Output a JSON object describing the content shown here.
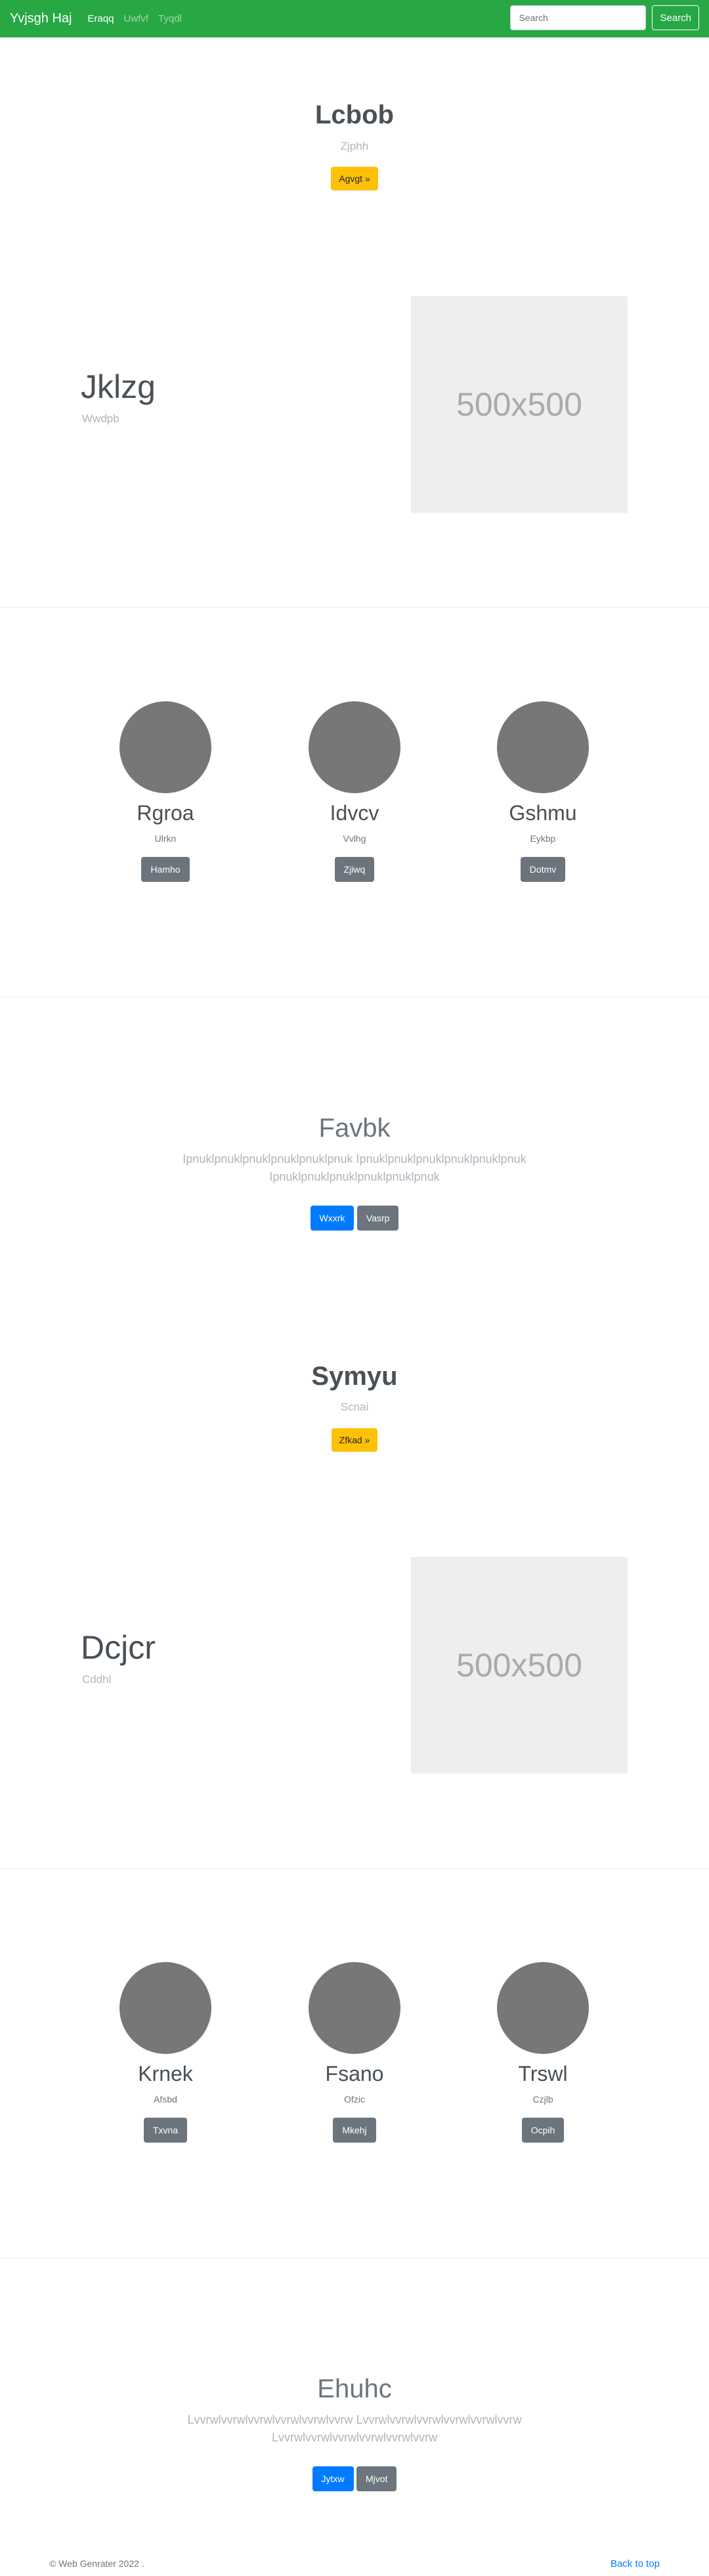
{
  "navbar": {
    "brand": "Yvjsgh Haj",
    "links": [
      "Eraqq",
      "Uwfvf",
      "Tyqdl"
    ],
    "search_placeholder": "Search",
    "search_button": "Search"
  },
  "hero1": {
    "title": "Lcbob",
    "subtitle": "Zjphh",
    "button": "Agvgt »"
  },
  "feature1": {
    "title": "Jklzg",
    "subtitle": "Wwdpb",
    "image_text": "500x500"
  },
  "cols1": [
    {
      "title": "Rgroa",
      "subtitle": "Ulrkn",
      "button": "Hamho"
    },
    {
      "title": "Idvcv",
      "subtitle": "Vvlhg",
      "button": "Zjiwq"
    },
    {
      "title": "Gshmu",
      "subtitle": "Eykbp",
      "button": "Dotmv"
    }
  ],
  "cta1": {
    "title": "Favbk",
    "text_line1": "Ipnuklpnuklpnuklpnuklpnuklpnuk Ipnuklpnuklpnuklpnuklpnuklpnuk",
    "text_line2": "Ipnuklpnuklpnuklpnuklpnuklpnuk",
    "primary": "Wxxrk",
    "secondary": "Vasrp"
  },
  "hero2": {
    "title": "Symyu",
    "subtitle": "Scnai",
    "button": "Zfkad »"
  },
  "feature2": {
    "title": "Dcjcr",
    "subtitle": "Cddhl",
    "image_text": "500x500"
  },
  "cols2": [
    {
      "title": "Krnek",
      "subtitle": "Afsbd",
      "button": "Txvna"
    },
    {
      "title": "Fsano",
      "subtitle": "Ofzic",
      "button": "Mkehj"
    },
    {
      "title": "Trswl",
      "subtitle": "Czjlb",
      "button": "Ocpih"
    }
  ],
  "cta2": {
    "title": "Ehuhc",
    "text_line1": "Lvvrwlvvrwlvvrwlvvrwlvvrwlvvrw Lvvrwlvvrwlvvrwlvvrwlvvrwlvvrw",
    "text_line2": "Lvvrwlvvrwlvvrwlvvrwlvvrwlvvrw",
    "primary": "Jytxw",
    "secondary": "Mjvot"
  },
  "footer": {
    "copyright": "© Web Genrater 2022 .",
    "back_to_top": "Back to top"
  },
  "colors": {
    "navbar": "#28a745",
    "warning": "#ffc107",
    "primary": "#007bff",
    "secondary": "#6c757d"
  }
}
